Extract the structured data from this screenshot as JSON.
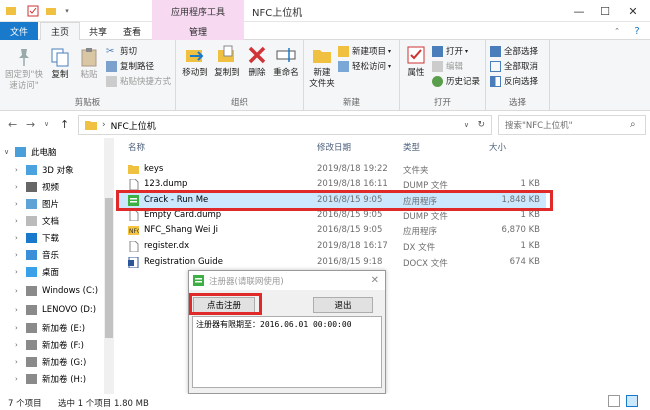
{
  "window": {
    "context_tools": "应用程序工具",
    "title": "NFC上位机",
    "minimize": "—",
    "maximize": "☐",
    "close": "✕"
  },
  "tabs": [
    {
      "label": "文件"
    },
    {
      "label": "主页"
    },
    {
      "label": "共享"
    },
    {
      "label": "查看"
    },
    {
      "label": "管理"
    }
  ],
  "ribbon": {
    "clipboard": {
      "pin": "固定到\"快速访问\"",
      "copy": "复制",
      "paste": "粘贴",
      "cut": "剪切",
      "copy_path": "复制路径",
      "paste_shortcut": "粘贴快捷方式",
      "label": "剪贴板"
    },
    "organize": {
      "move_to": "移动到",
      "copy_to": "复制到",
      "delete": "删除",
      "rename": "重命名",
      "label": "组织"
    },
    "new": {
      "new_folder": "新建\n文件夹",
      "new_item": "新建项目",
      "easy_access": "轻松访问",
      "label": "新建"
    },
    "open": {
      "properties": "属性",
      "open": "打开",
      "edit": "编辑",
      "history": "历史记录",
      "label": "打开"
    },
    "select": {
      "select_all": "全部选择",
      "select_none": "全部取消",
      "invert": "反向选择",
      "label": "选择"
    }
  },
  "address": {
    "path": "NFC上位机",
    "search_placeholder": "搜索\"NFC上位机\""
  },
  "nav_items": [
    {
      "label": "此电脑"
    },
    {
      "label": "3D 对象"
    },
    {
      "label": "视频"
    },
    {
      "label": "图片"
    },
    {
      "label": "文档"
    },
    {
      "label": "下载"
    },
    {
      "label": "音乐"
    },
    {
      "label": "桌面"
    },
    {
      "label": "Windows (C:)"
    },
    {
      "label": "LENOVO (D:)"
    },
    {
      "label": "新加卷 (E:)"
    },
    {
      "label": "新加卷 (F:)"
    },
    {
      "label": "新加卷 (G:)"
    },
    {
      "label": "新加卷 (H:)"
    }
  ],
  "columns": {
    "name": "名称",
    "date": "修改日期",
    "type": "类型",
    "size": "大小"
  },
  "files": [
    {
      "name": "keys",
      "date": "2019/8/18 19:22",
      "type": "文件夹",
      "size": "",
      "icon": "folder-icon"
    },
    {
      "name": "123.dump",
      "date": "2019/8/18 16:11",
      "type": "DUMP 文件",
      "size": "1 KB",
      "icon": "file-icon"
    },
    {
      "name": "Crack - Run Me",
      "date": "2016/8/15 9:05",
      "type": "应用程序",
      "size": "1,848 KB",
      "icon": "app-icon"
    },
    {
      "name": "Empty Card.dump",
      "date": "2016/8/15 9:05",
      "type": "DUMP 文件",
      "size": "1 KB",
      "icon": "file-icon"
    },
    {
      "name": "NFC_Shang Wei Ji",
      "date": "2016/8/15 9:05",
      "type": "应用程序",
      "size": "6,870 KB",
      "icon": "app-icon"
    },
    {
      "name": "register.dx",
      "date": "2019/8/18 16:17",
      "type": "DX 文件",
      "size": "1 KB",
      "icon": "file-icon"
    },
    {
      "name": "Registration Guide",
      "date": "2016/8/15 9:18",
      "type": "DOCX 文件",
      "size": "674 KB",
      "icon": "word-icon"
    }
  ],
  "dialog": {
    "title": "注册器(请联网使用)",
    "register": "点击注册",
    "exit": "退出",
    "output": "注册器有限期至：2016.06.01  00:00:00"
  },
  "status": {
    "count": "7 个项目",
    "selected": "选中 1 个项目  1.80 MB"
  },
  "colors": {
    "accent": "#1979ca",
    "selection": "#cce8ff",
    "highlight": "#e02a2a",
    "context": "#f7d9f2"
  }
}
